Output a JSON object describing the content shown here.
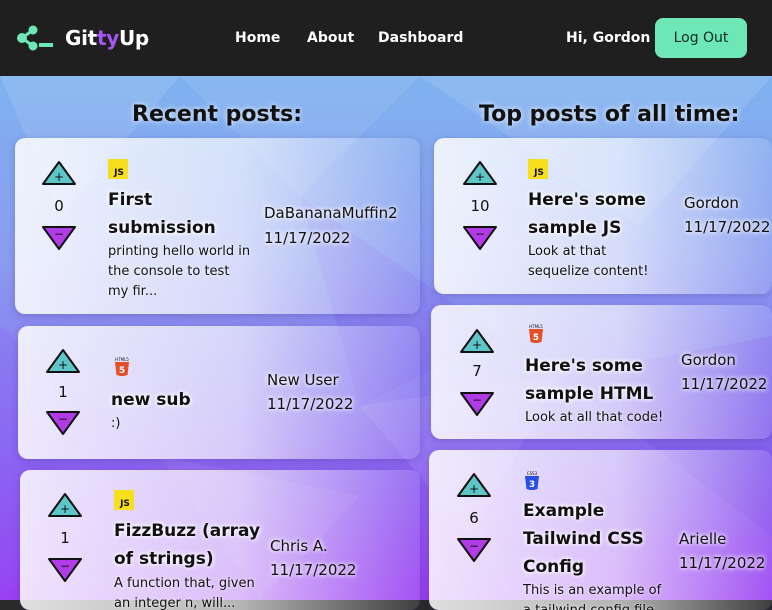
{
  "nav": {
    "brand_prefix": "Git",
    "brand_mid": "ty",
    "brand_suffix": "Up",
    "links": [
      "Home",
      "About",
      "Dashboard"
    ],
    "greeting": "Hi, Gordon",
    "logout": "Log Out"
  },
  "recent": {
    "heading": "Recent posts:",
    "posts": [
      {
        "votes": "0",
        "lang": "JS",
        "title": "First submission",
        "desc": "printing hello world in the console to test my fir...",
        "author": "DaBananaMuffin2",
        "date": "11/17/2022"
      },
      {
        "votes": "1",
        "lang": "HTML5",
        "title": "new sub",
        "desc": ":)",
        "author": "New User",
        "date": "11/17/2022"
      },
      {
        "votes": "1",
        "lang": "JS",
        "title": "FizzBuzz (array of strings)",
        "desc": "A function that, given an integer n, will...",
        "author": "Chris A.",
        "date": "11/17/2022"
      }
    ]
  },
  "top": {
    "heading": "Top posts of all time:",
    "posts": [
      {
        "votes": "10",
        "lang": "JS",
        "title": "Here's some sample JS",
        "desc": "Look at that sequelize content!",
        "author": "Gordon",
        "date": "11/17/2022"
      },
      {
        "votes": "7",
        "lang": "HTML5",
        "title": "Here's some sample HTML",
        "desc": "Look at all that code!",
        "author": "Gordon",
        "date": "11/17/2022"
      },
      {
        "votes": "6",
        "lang": "CSS3",
        "title": "Example Tailwind CSS Config",
        "desc": "This is an example of a tailwind config file",
        "author": "Arielle",
        "date": "11/17/2022"
      }
    ]
  },
  "colors": {
    "nav_bg": "#1f1f1f",
    "logout_bg": "#6ee7b7",
    "brand_accent": "#a855f7",
    "upvote": "#5ec6c9",
    "downvote": "#b23be8",
    "js": "#f7df1e",
    "html": "#e34f26",
    "css": "#264de4"
  }
}
